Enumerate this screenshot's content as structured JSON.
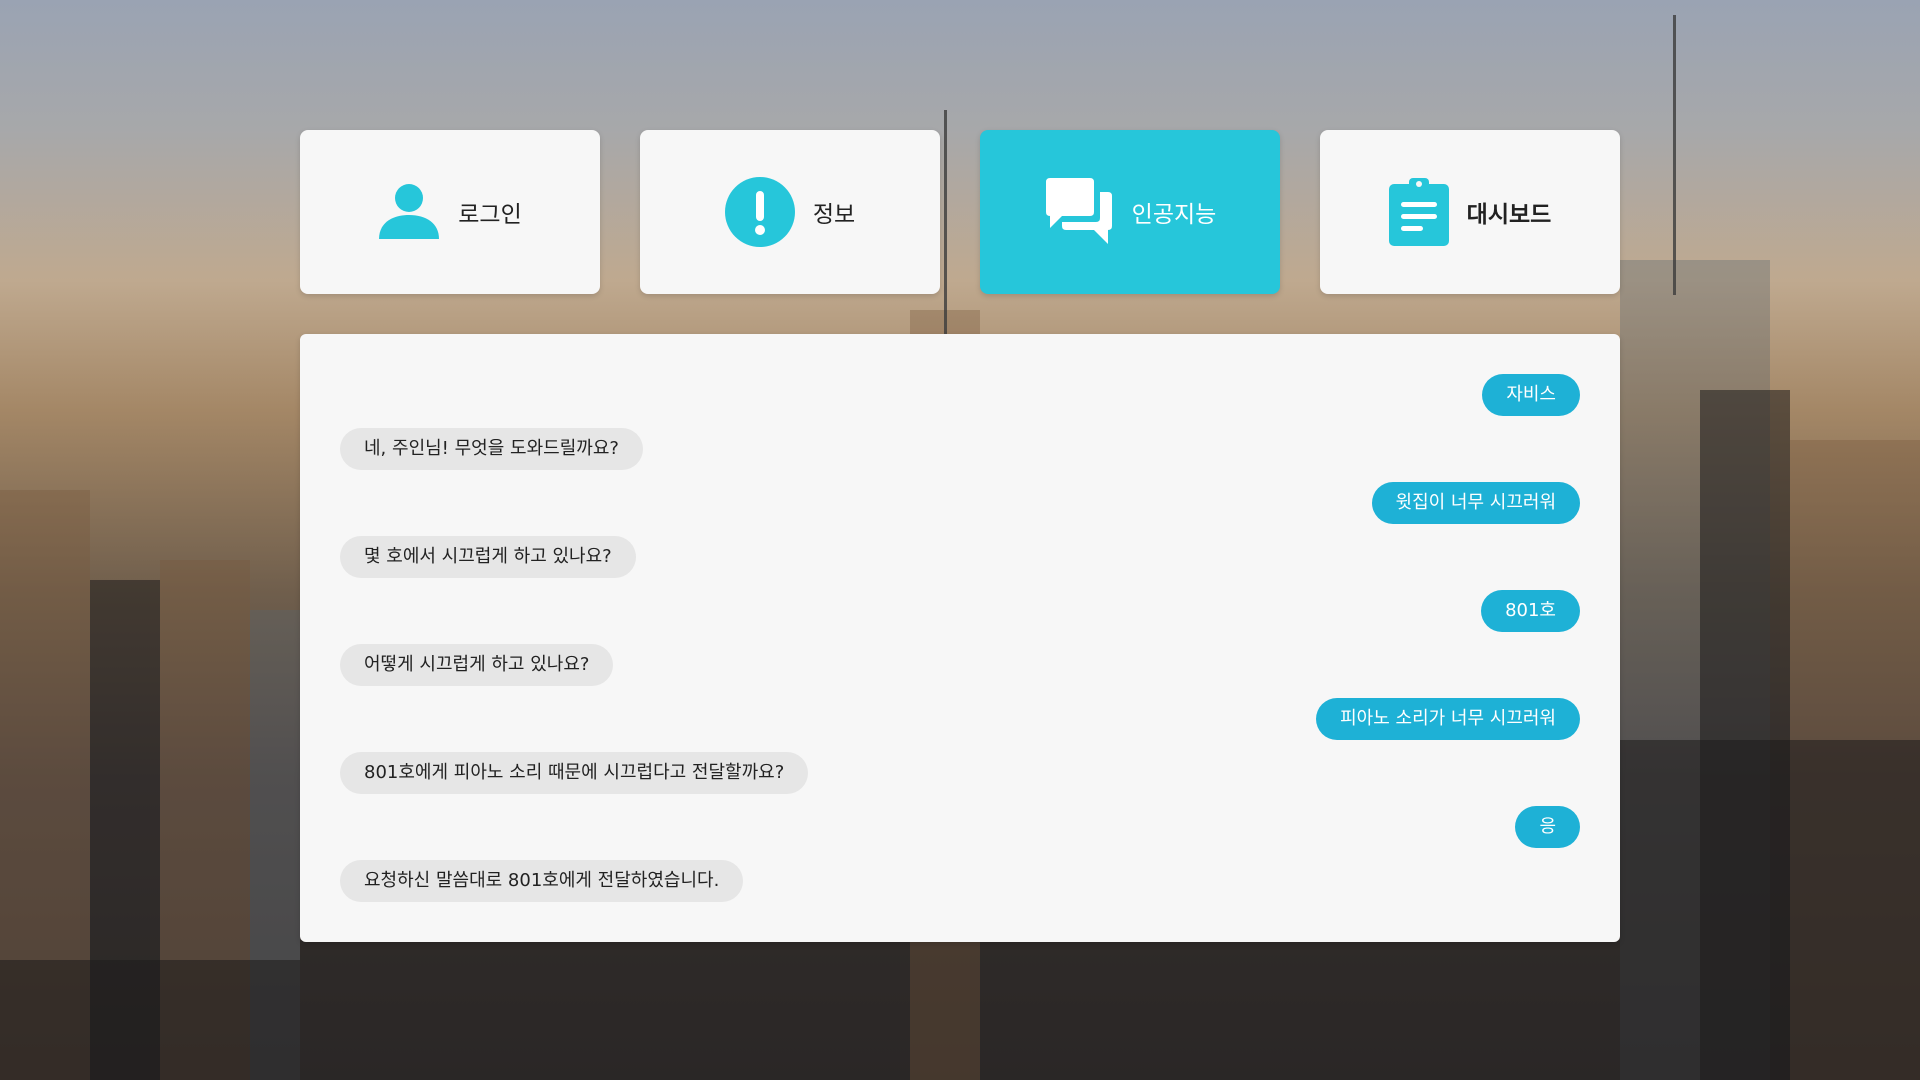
{
  "nav": {
    "items": [
      {
        "label": "로그인",
        "icon": "user-icon",
        "active": false
      },
      {
        "label": "정보",
        "icon": "alert-circle-icon",
        "active": false
      },
      {
        "label": "인공지능",
        "icon": "chat-bubbles-icon",
        "active": true
      },
      {
        "label": "대시보드",
        "icon": "clipboard-icon",
        "active": false
      }
    ]
  },
  "chat": {
    "messages": [
      {
        "sender": "user",
        "text": "자비스"
      },
      {
        "sender": "bot",
        "text": "네, 주인님! 무엇을 도와드릴까요?"
      },
      {
        "sender": "user",
        "text": "윗집이 너무 시끄러워"
      },
      {
        "sender": "bot",
        "text": "몇 호에서 시끄럽게 하고 있나요?"
      },
      {
        "sender": "user",
        "text": "801호"
      },
      {
        "sender": "bot",
        "text": "어떻게 시끄럽게 하고 있나요?"
      },
      {
        "sender": "user",
        "text": "피아노 소리가 너무 시끄러워"
      },
      {
        "sender": "bot",
        "text": "801호에게 피아노 소리 때문에 시끄럽다고 전달할까요?"
      },
      {
        "sender": "user",
        "text": "응"
      },
      {
        "sender": "bot",
        "text": "요청하신 말씀대로 801호에게 전달하였습니다."
      }
    ]
  },
  "colors": {
    "accent": "#26c6da",
    "user_bubble": "#1eb1d6",
    "bot_bubble": "#e6e6e6",
    "card": "#f7f7f7"
  }
}
